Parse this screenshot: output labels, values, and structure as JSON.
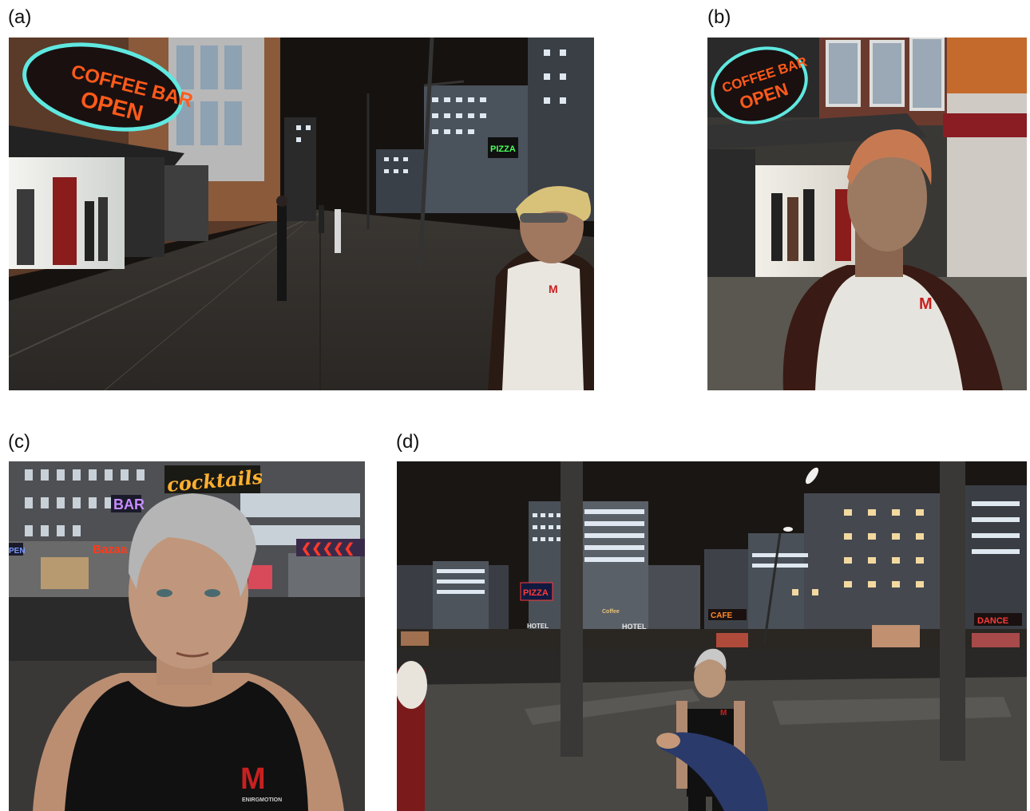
{
  "figure": {
    "labels": {
      "a": "(a)",
      "b": "(b)",
      "c": "(c)",
      "d": "(d)"
    }
  },
  "panel_a": {
    "sign_line1": "COFFEE BAR",
    "sign_line2": "OPEN",
    "sign_pizza": "PIZZA",
    "shirt_logo": "M"
  },
  "panel_b": {
    "sign_line1": "COFFEE BAR",
    "sign_line2": "OPEN",
    "shirt_logo": "M"
  },
  "panel_c": {
    "sign_cocktails": "cocktails",
    "sign_bar": "BAR",
    "sign_bazaar": "Bazaa",
    "sign_open_fragment": "PEN",
    "shirt_logo": "M",
    "shirt_brand": "ENIRGMOTION"
  },
  "panel_d": {
    "sign_pizza": "PIZZA",
    "sign_hotel_left": "HOTEL",
    "sign_hotel_center": "HOTEL",
    "sign_cafe": "CAFE",
    "sign_dance": "DANCE",
    "sign_coffee": "Coffee",
    "shirt_logo": "M"
  },
  "colors": {
    "neon_orange": "#ff5a1a",
    "neon_teal": "#5fe8e0",
    "neon_red": "#ff2a2a",
    "neon_purple": "#c78cff",
    "night_sky": "#1a1613",
    "window_light": "#dfe8f0"
  }
}
